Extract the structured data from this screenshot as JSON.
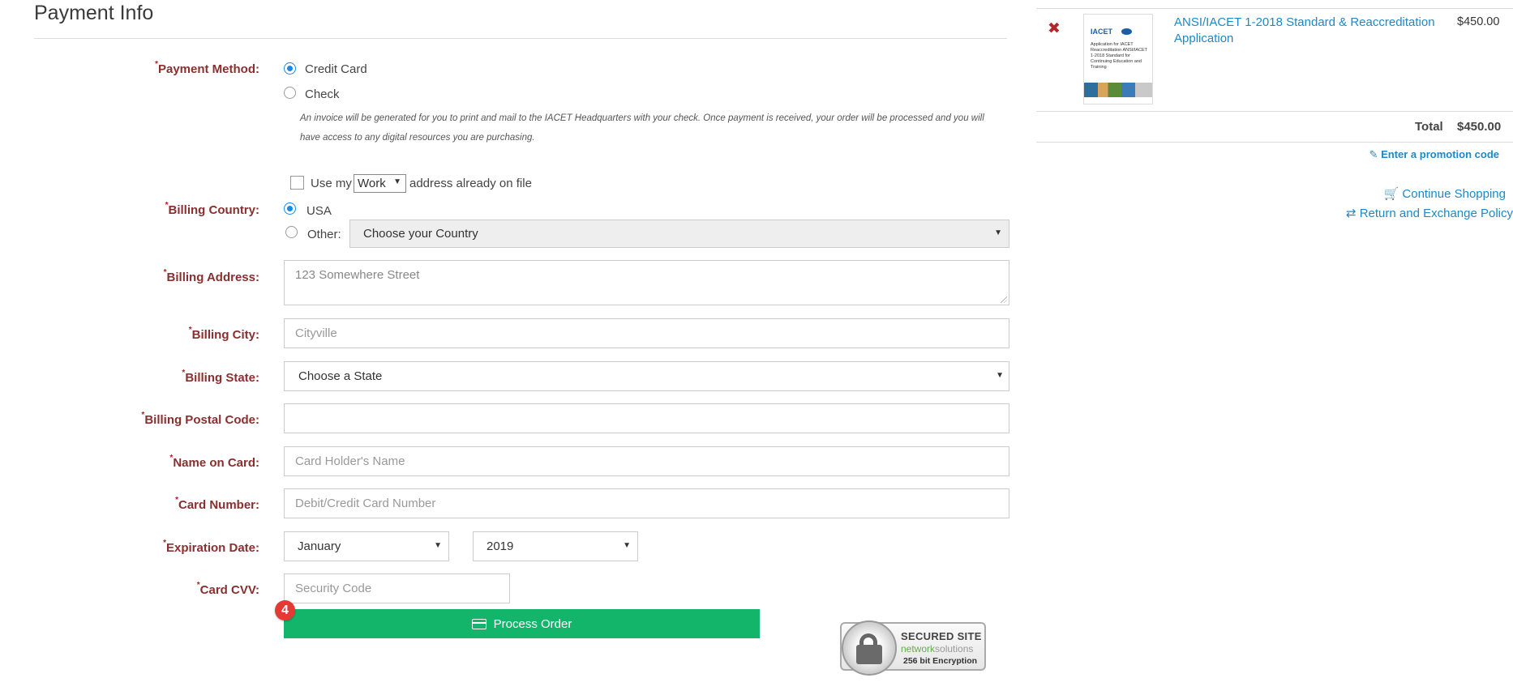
{
  "page": {
    "title": "Payment Info"
  },
  "payment_method": {
    "label": "Payment Method:",
    "options": [
      {
        "label": "Credit Card",
        "selected": true
      },
      {
        "label": "Check",
        "selected": false
      }
    ],
    "check_note": "An invoice will be generated for you to print and mail to the IACET Headquarters with your check. Once payment is received, your order will be processed and you will have access to any digital resources you are purchasing."
  },
  "address_on_file": {
    "prefix": "Use my",
    "selected": "Work",
    "suffix": "address already on file",
    "checked": false
  },
  "billing_country": {
    "label": "Billing Country:",
    "usa": "USA",
    "other": "Other:",
    "country_placeholder": "Choose your Country"
  },
  "billing_address": {
    "label": "Billing Address:",
    "placeholder": "123 Somewhere Street"
  },
  "billing_city": {
    "label": "Billing City:",
    "placeholder": "Cityville"
  },
  "billing_state": {
    "label": "Billing State:",
    "value": "Choose a State"
  },
  "billing_postal": {
    "label": "Billing Postal Code:",
    "value": ""
  },
  "name_on_card": {
    "label": "Name on Card:",
    "placeholder": "Card Holder's Name"
  },
  "card_number": {
    "label": "Card Number:",
    "placeholder": "Debit/Credit Card Number"
  },
  "expiration": {
    "label": "Expiration Date:",
    "month": "January",
    "year": "2019"
  },
  "cvv": {
    "label": "Card CVV:",
    "placeholder": "Security Code"
  },
  "process": {
    "label": "Process Order",
    "badge": "4"
  },
  "seal": {
    "title": "SECURED SITE",
    "brand_a": "network",
    "brand_b": "solutions",
    "encryption": "256 bit Encryption"
  },
  "cart": {
    "items": [
      {
        "name": "ANSI/IACET 1-2018 Standard & Reaccreditation Application",
        "price": "$450.00",
        "thumb_logo": "IACET",
        "thumb_text": "Application for IACET Reaccreditation ANSI/IACET 1-2018 Standard for Continuing Education and Training"
      }
    ],
    "total_label": "Total",
    "total_value": "$450.00",
    "promo": "Enter a promotion code",
    "continue": "Continue Shopping",
    "return_policy": "Return and Exchange Policy"
  },
  "colors": {
    "accent": "#1e88c8",
    "button": "#13b56a",
    "label": "#8a2f2f",
    "badge": "#e53935"
  }
}
